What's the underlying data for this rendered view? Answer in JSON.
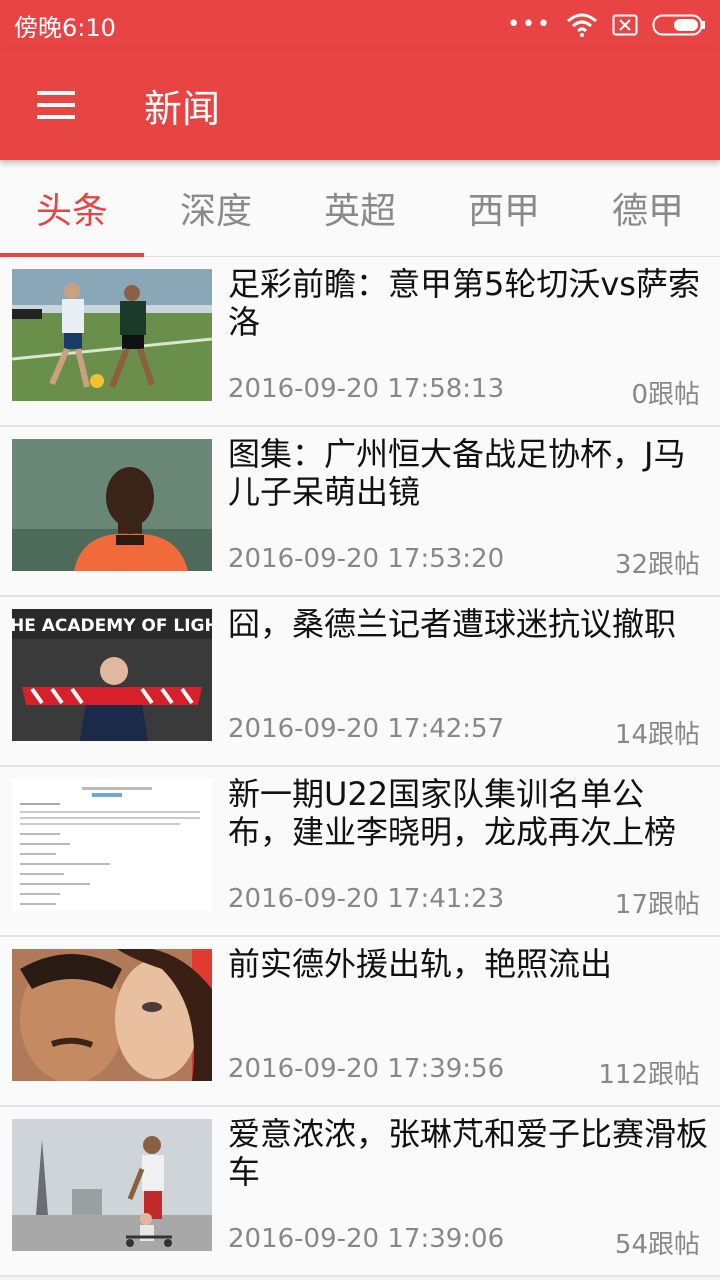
{
  "status_bar": {
    "time": "傍晚6:10"
  },
  "app_bar": {
    "title": "新闻",
    "menu_icon": "hamburger-menu-icon"
  },
  "tabs": [
    {
      "label": "头条",
      "active": true
    },
    {
      "label": "深度",
      "active": false
    },
    {
      "label": "英超",
      "active": false
    },
    {
      "label": "西甲",
      "active": false
    },
    {
      "label": "德甲",
      "active": false
    }
  ],
  "colors": {
    "primary": "#e84444",
    "tab_inactive": "#8a8a8a",
    "meta": "#888888"
  },
  "news": [
    {
      "title": "足彩前瞻：意甲第5轮切沃vs萨索洛",
      "time": "2016-09-20 17:58:13",
      "comments": "0跟帖"
    },
    {
      "title": "图集：广州恒大备战足协杯，J马儿子呆萌出镜",
      "time": "2016-09-20 17:53:20",
      "comments": "32跟帖"
    },
    {
      "title": "囧，桑德兰记者遭球迷抗议撤职",
      "time": "2016-09-20 17:42:57",
      "comments": "14跟帖",
      "thumb_text": "HE ACADEMY OF LIGHT"
    },
    {
      "title": "新一期U22国家队集训名单公布，建业李晓明，龙成再次上榜",
      "time": "2016-09-20 17:41:23",
      "comments": "17跟帖"
    },
    {
      "title": "前实德外援出轨，艳照流出",
      "time": "2016-09-20 17:39:56",
      "comments": "112跟帖"
    },
    {
      "title": "爱意浓浓，张琳芃和爱子比赛滑板车",
      "time": "2016-09-20 17:39:06",
      "comments": "54跟帖"
    }
  ]
}
